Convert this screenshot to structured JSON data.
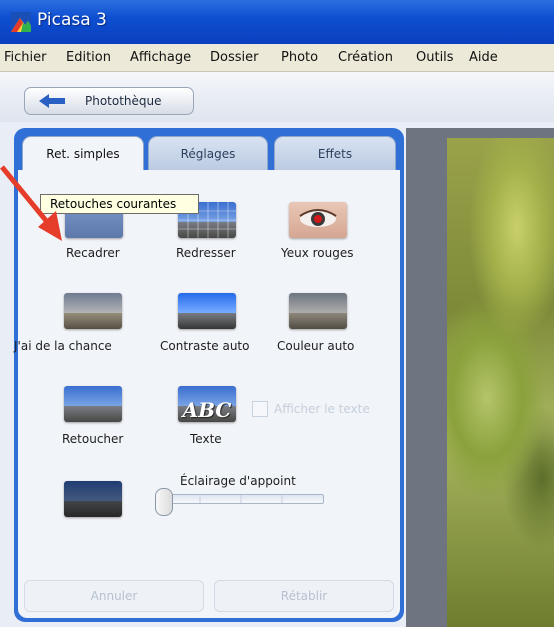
{
  "window": {
    "title": "Picasa 3"
  },
  "menu": [
    "Fichier",
    "Edition",
    "Affichage",
    "Dossier",
    "Photo",
    "Création",
    "Outils",
    "Aide"
  ],
  "toolbar": {
    "back_label": "Photothèque"
  },
  "tabs": [
    {
      "label": "Ret. simples",
      "active": true
    },
    {
      "label": "Réglages",
      "active": false
    },
    {
      "label": "Effets",
      "active": false
    }
  ],
  "tooltip": "Retouches courantes",
  "tools": {
    "recadrer": "Recadrer",
    "redresser": "Redresser",
    "yeux_rouges": "Yeux rouges",
    "chance": "J'ai de la chance",
    "contraste": "Contraste auto",
    "couleur": "Couleur auto",
    "retoucher": "Retoucher",
    "texte": "Texte",
    "texte_thumb": "ABC"
  },
  "checkbox": {
    "label": "Afficher le texte",
    "checked": false
  },
  "slider": {
    "label": "Éclairage d'appoint",
    "value": 0
  },
  "buttons": {
    "annuler": "Annuler",
    "retablir": "Rétablir"
  },
  "colors": {
    "titlebar": "#0e4fd1",
    "panel": "#2f6fd6",
    "arrow": "#e53d2a"
  }
}
